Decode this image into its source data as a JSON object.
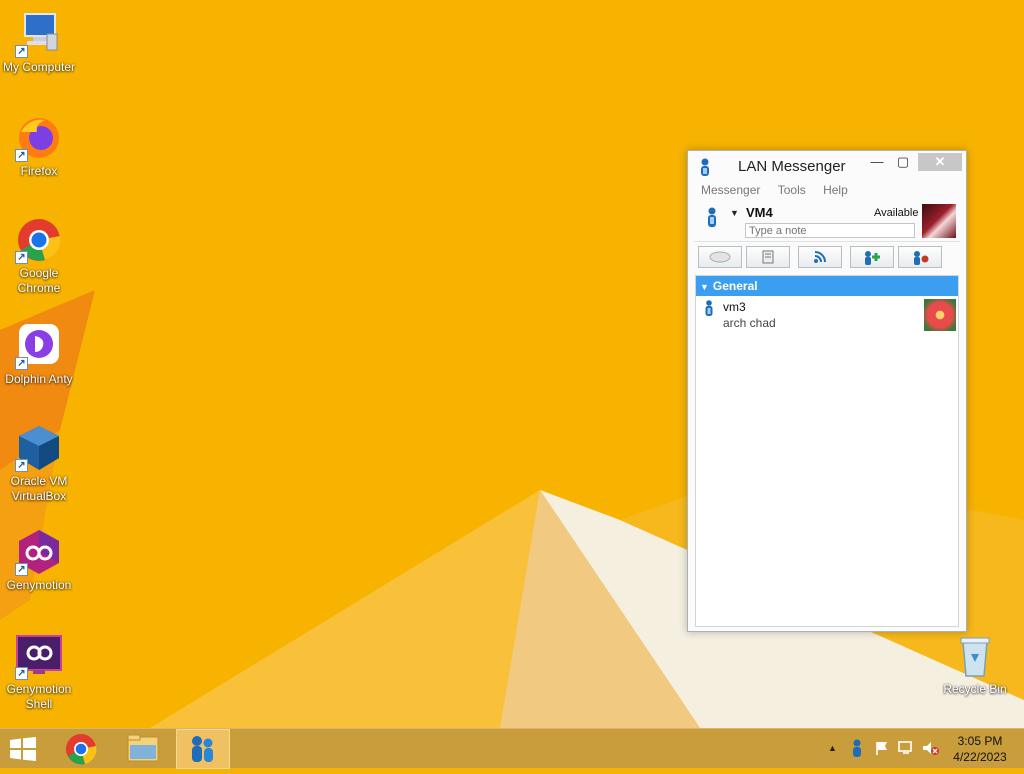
{
  "desktop": {
    "icons": [
      {
        "label": "My Computer"
      },
      {
        "label": "Firefox"
      },
      {
        "label": "Google Chrome"
      },
      {
        "label": "Dolphin Anty"
      },
      {
        "label": "Oracle VM VirtualBox"
      },
      {
        "label": "Genymotion"
      },
      {
        "label": "Genymotion Shell"
      },
      {
        "label": "Recycle Bin"
      }
    ]
  },
  "window": {
    "title": "LAN Messenger",
    "menu": [
      "Messenger",
      "Tools",
      "Help"
    ],
    "user": {
      "name": "VM4",
      "status": "Available",
      "note_placeholder": "Type a note"
    },
    "group": {
      "name": "General"
    },
    "contacts": [
      {
        "name": "vm3",
        "note": "arch chad"
      }
    ]
  },
  "taskbar": {
    "clock_time": "3:05 PM",
    "clock_date": "4/22/2023"
  },
  "colors": {
    "wallpaper": "#f6b205",
    "selection": "#3c9ef1",
    "taskbar": "#c99d3c"
  }
}
